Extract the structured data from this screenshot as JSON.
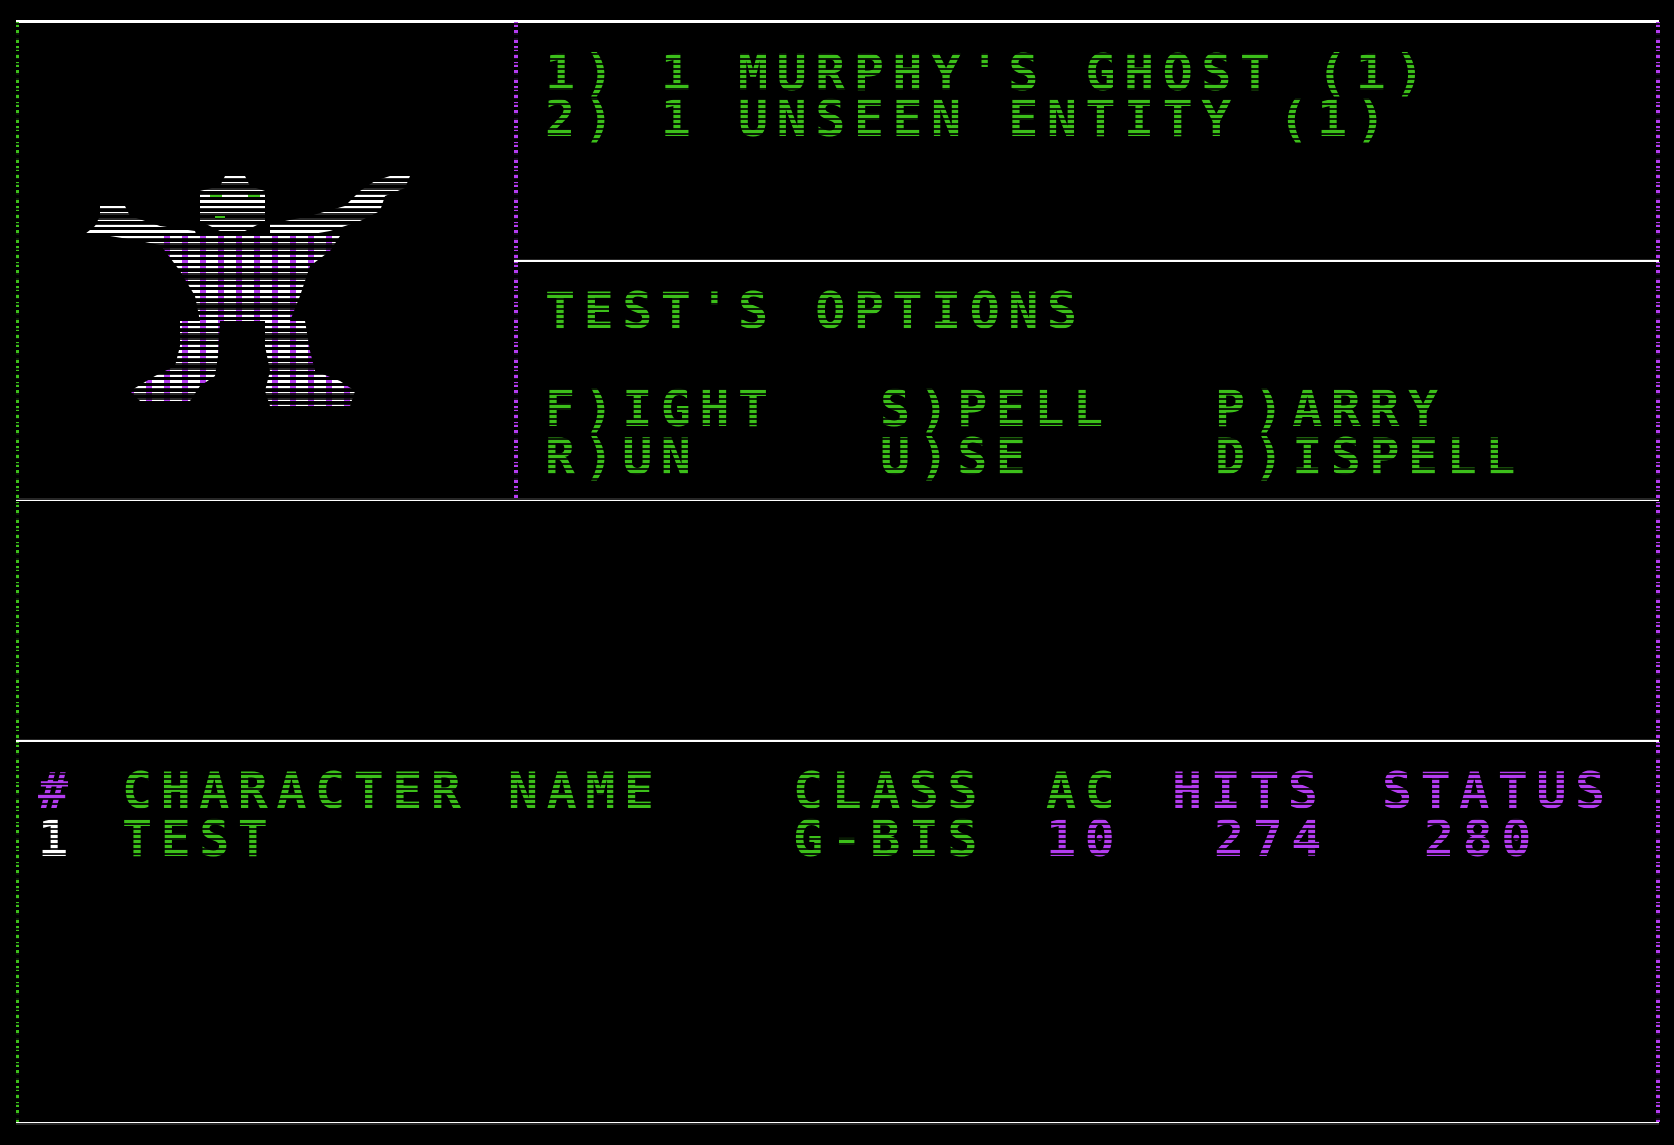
{
  "monsters": [
    {
      "label": "1) 1 MURPHY'S GHOST (1)"
    },
    {
      "label": "2) 1 UNSEEN ENTITY (1)"
    }
  ],
  "options": {
    "title": "TEST'S OPTIONS",
    "fight": "F)IGHT",
    "spell": "S)PELL",
    "parry": "P)ARRY",
    "run": "R)UN",
    "use": "U)SE",
    "dispell": "D)ISPELL"
  },
  "party": {
    "header": {
      "num": "#",
      "name": "CHARACTER NAME",
      "class": "CLASS",
      "ac": "AC",
      "hits": "HITS",
      "status": "STATUS"
    },
    "rows": [
      {
        "num": "1",
        "name": "TEST",
        "class": "G-BIS",
        "ac": "10",
        "hits": "274",
        "status": "280"
      }
    ]
  },
  "colors": {
    "background": "#000000",
    "white": "#ffffff",
    "green": "#3cbf1a",
    "purple": "#b43cf0"
  },
  "icons": {
    "monster_picture": "ghost-icon"
  }
}
